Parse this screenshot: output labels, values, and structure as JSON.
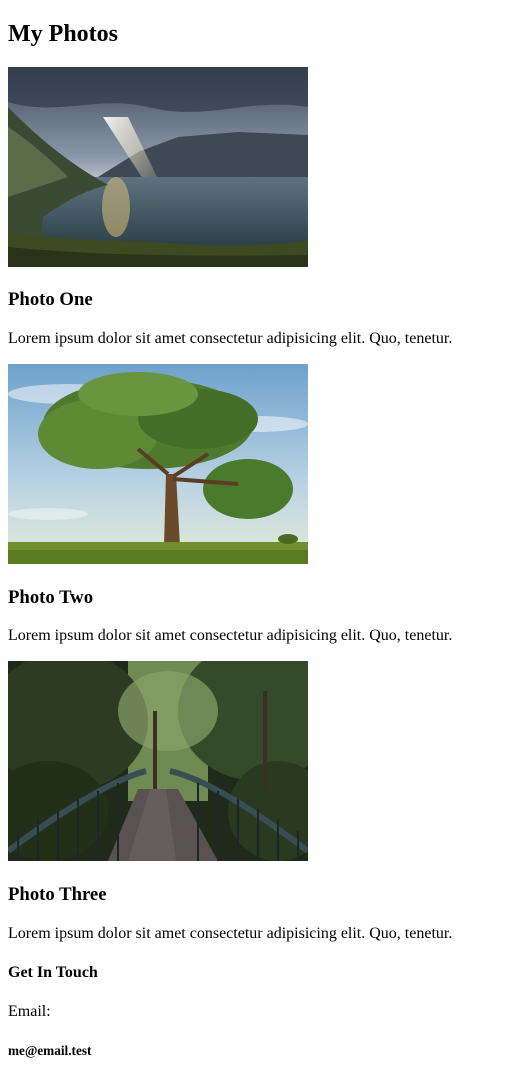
{
  "page": {
    "title": "My Photos"
  },
  "photos": [
    {
      "image": "lake-mountains-sunbeam-photo",
      "title": "Photo One",
      "caption": "Lorem ipsum dolor sit amet consectetur adipisicing elit. Quo, tenetur."
    },
    {
      "image": "lone-tree-field-photo",
      "title": "Photo Two",
      "caption": "Lorem ipsum dolor sit amet consectetur adipisicing elit. Quo, tenetur."
    },
    {
      "image": "forest-bridge-photo",
      "title": "Photo Three",
      "caption": "Lorem ipsum dolor sit amet consectetur adipisicing elit. Quo, tenetur."
    }
  ],
  "contact": {
    "heading": "Get In Touch",
    "email_label": "Email:",
    "email_value": "me@email.test"
  }
}
